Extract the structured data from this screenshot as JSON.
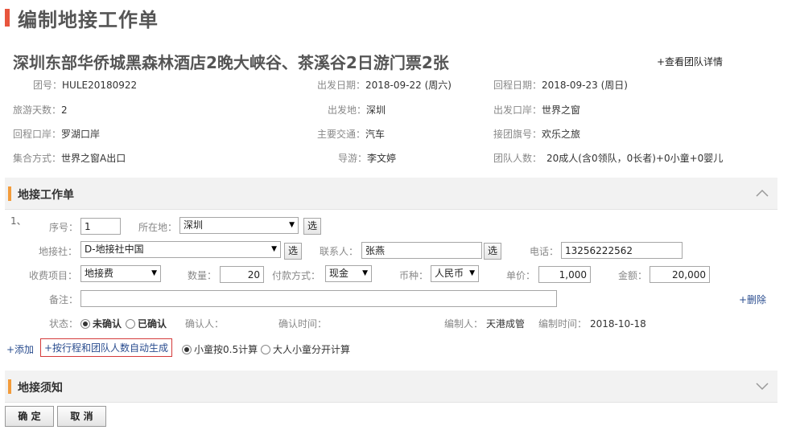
{
  "page": {
    "title": "编制地接工作单"
  },
  "tour": {
    "title": "深圳东部华侨城黑森林酒店2晚大峡谷、茶溪谷2日游门票2张",
    "view_team_link": "+查看团队详情"
  },
  "info": {
    "group_no_label": "团号：",
    "group_no": "HULE20180922",
    "depart_date_label": "出发日期：",
    "depart_date": "2018-09-22 (周六)",
    "return_date_label": "回程日期：",
    "return_date": "2018-09-23 (周日)",
    "days_label": "旅游天数：",
    "days": "2",
    "depart_place_label": "出发地：",
    "depart_place": "深圳",
    "depart_port_label": "出发口岸：",
    "depart_port": "世界之窗",
    "return_port_label": "回程口岸：",
    "return_port": "罗湖口岸",
    "transport_label": "主要交通：",
    "transport": "汽车",
    "flag_label": "接团旗号：",
    "flag": "欢乐之旅",
    "meeting_label": "集合方式：",
    "meeting": "世界之窗A出口",
    "guide_label": "导游：",
    "guide": "李文婷",
    "people_label": "团队人数：",
    "people": "20成人(含0领队，0长者)+0小童+0婴儿"
  },
  "worksheet_section": {
    "title": "地接工作单"
  },
  "item": {
    "index": "1、",
    "seq_label": "序号：",
    "seq": "1",
    "location_label": "所在地：",
    "location": "深圳",
    "pick_label": "选",
    "agency_label": "地接社：",
    "agency": "D-地接社中国",
    "contact_label": "联系人：",
    "contact": "张燕",
    "phone_label": "电话：",
    "phone": "13256222562",
    "fee_item_label": "收费项目：",
    "fee_item": "地接费",
    "qty_label": "数量：",
    "qty": "20",
    "pay_label": "付款方式：",
    "pay": "现金",
    "currency_label": "币种：",
    "currency": "人民币",
    "price_label": "单价：",
    "price": "1,000",
    "amount_label": "金额：",
    "amount": "20,000",
    "remark_label": "备注：",
    "remark": "",
    "delete_link": "+删除",
    "status_label": "状态：",
    "status_unconfirmed": "未确认",
    "status_confirmed": "已确认",
    "confirmer_label": "确认人：",
    "confirm_time_label": "确认时间：",
    "editor_label": "编制人：",
    "editor": "天港成管",
    "edit_time_label": "编制时间：",
    "edit_time": "2018-10-18"
  },
  "actions": {
    "add_link": "+添加",
    "auto_gen_link": "+按行程和团队人数自动生成",
    "child_half": "小童按0.5计算",
    "split_calc": "大人小童分开计算"
  },
  "notice_section": {
    "title": "地接须知"
  },
  "buttons": {
    "confirm": "确 定",
    "cancel": "取 消"
  },
  "colors": {
    "title_bar": "#e8553d",
    "section_marker": "#f39c3b",
    "auto_gen_border": "#d43a3a"
  }
}
